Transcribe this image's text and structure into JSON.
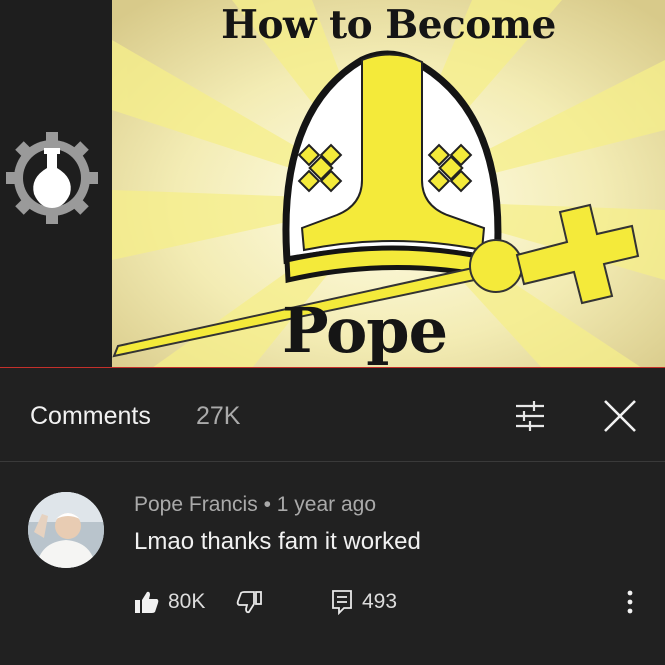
{
  "video": {
    "thumbnail": {
      "title_line": "How to Become",
      "title_word": "Pope"
    },
    "channel_logo_icon": "flask-gear-logo-icon",
    "progress_color": "#c4302b"
  },
  "comments_panel": {
    "title": "Comments",
    "count": "27K",
    "filter_icon": "sliders-icon",
    "close_icon": "close-icon"
  },
  "comment": {
    "author": "Pope Francis",
    "separator": " • ",
    "time": "1 year ago",
    "text": "Lmao thanks fam it worked",
    "likes": "80K",
    "replies": "493",
    "like_icon": "thumbs-up-icon",
    "dislike_icon": "thumbs-down-icon",
    "reply_icon": "reply-icon",
    "more_icon": "more-vertical-icon"
  },
  "colors": {
    "background": "#212121",
    "thumbnail_yellow": "#f4ea3a",
    "text_primary": "#f1f1f1",
    "text_secondary": "#aaaaaa"
  }
}
